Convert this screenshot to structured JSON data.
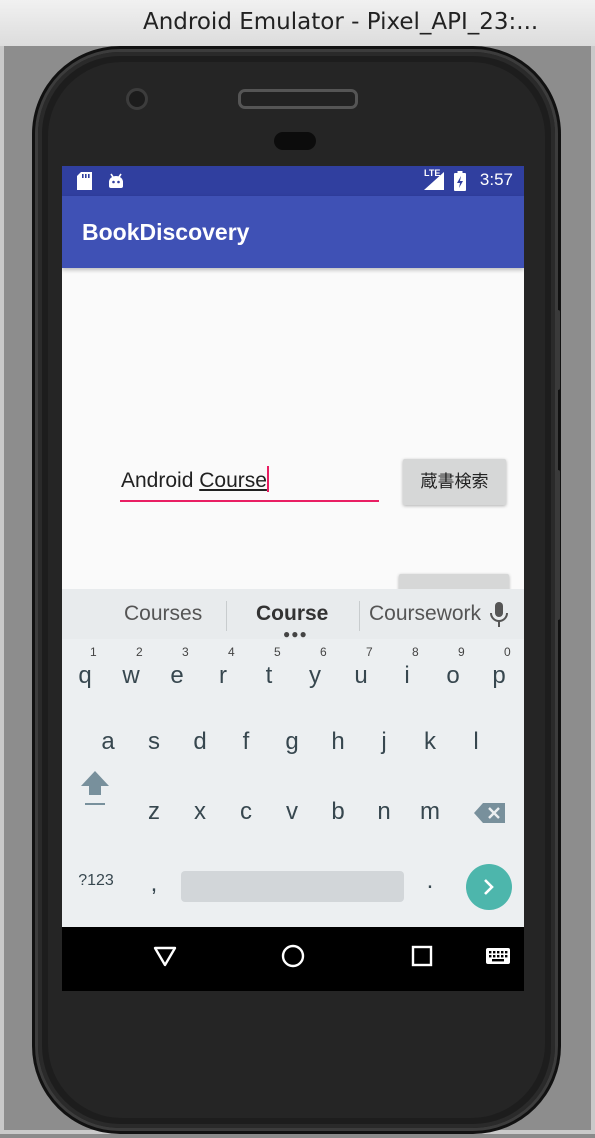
{
  "window": {
    "title": "Android Emulator - Pixel_API_23:..."
  },
  "status_bar": {
    "time": "3:57",
    "network": "LTE",
    "icons": [
      "sd-card-icon",
      "android-debug-icon",
      "signal-icon",
      "battery-charging-icon"
    ]
  },
  "app_bar": {
    "title": "BookDiscovery"
  },
  "search_field": {
    "value_plain": "Android ",
    "value_composing": "Course"
  },
  "search_button": {
    "label": "蔵書検索"
  },
  "keyboard": {
    "suggestions": [
      "Courses",
      "Course",
      "Coursework"
    ],
    "row1": [
      {
        "key": "q",
        "hint": "1"
      },
      {
        "key": "w",
        "hint": "2"
      },
      {
        "key": "e",
        "hint": "3"
      },
      {
        "key": "r",
        "hint": "4"
      },
      {
        "key": "t",
        "hint": "5"
      },
      {
        "key": "y",
        "hint": "6"
      },
      {
        "key": "u",
        "hint": "7"
      },
      {
        "key": "i",
        "hint": "8"
      },
      {
        "key": "o",
        "hint": "9"
      },
      {
        "key": "p",
        "hint": "0"
      }
    ],
    "row2": [
      "a",
      "s",
      "d",
      "f",
      "g",
      "h",
      "j",
      "k",
      "l"
    ],
    "row3": [
      "z",
      "x",
      "c",
      "v",
      "b",
      "n",
      "m"
    ],
    "symbols_label": "?123",
    "comma_label": ",",
    "period_label": "."
  },
  "colors": {
    "status_bar": "#303f9f",
    "app_bar": "#3f51b5",
    "accent": "#e91e63",
    "enter_key": "#4db6ac"
  }
}
